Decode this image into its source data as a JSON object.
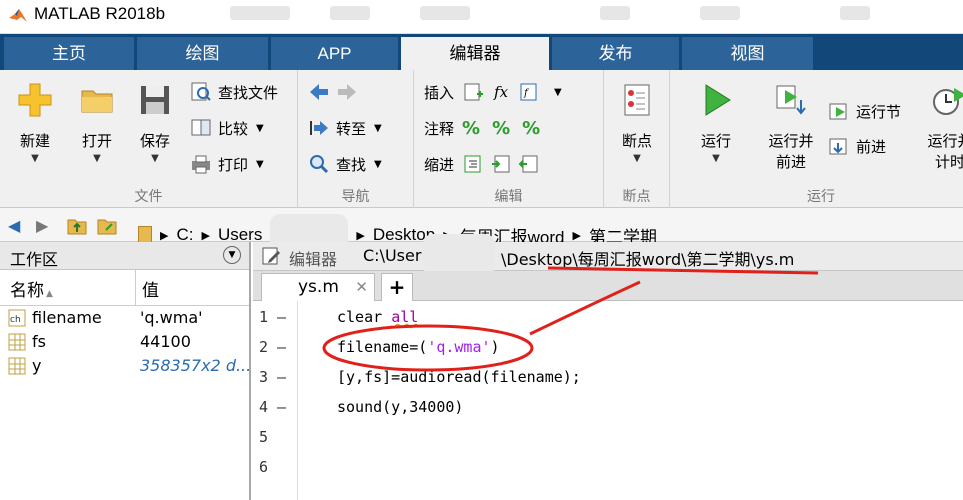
{
  "app": {
    "title": "MATLAB R2018b"
  },
  "tabs": [
    {
      "label": "主页",
      "active": false
    },
    {
      "label": "绘图",
      "active": false
    },
    {
      "label": "APP",
      "active": false
    },
    {
      "label": "编辑器",
      "active": true
    },
    {
      "label": "发布",
      "active": false
    },
    {
      "label": "视图",
      "active": false
    }
  ],
  "ribbon": {
    "file": {
      "label": "文件",
      "new": "新建",
      "open": "打开",
      "save": "保存",
      "find_files": "查找文件",
      "compare": "比较",
      "print": "打印"
    },
    "nav": {
      "label": "导航",
      "goto": "转至",
      "find": "查找"
    },
    "edit": {
      "label": "编辑",
      "insert": "插入",
      "comment": "注释",
      "indent": "缩进",
      "fx": "fx"
    },
    "breakpoints": {
      "label": "断点",
      "button": "断点"
    },
    "run": {
      "label": "运行",
      "run": "运行",
      "run_advance_1": "运行并",
      "run_advance_2": "前进",
      "run_section": "运行节",
      "advance": "前进",
      "run_time_1": "运行并",
      "run_time_2": "计时"
    }
  },
  "address": {
    "drive": "C:",
    "users": "Users",
    "desktop": "Desktop",
    "folder1": "每周汇报word",
    "folder2": "第二学期"
  },
  "workspace": {
    "title": "工作区",
    "col_name": "名称",
    "col_value": "值",
    "vars": [
      {
        "name": "filename",
        "value": "'q.wma'",
        "icon": "char-icon"
      },
      {
        "name": "fs",
        "value": "44100",
        "icon": "matrix-icon"
      },
      {
        "name": "y",
        "value": "358357x2 d...",
        "icon": "matrix-icon"
      }
    ]
  },
  "editor": {
    "header_prefix": "编辑器",
    "path_a": "C:\\User",
    "path_b": "\\Desktop\\每周汇报word\\第二学期\\ys.m",
    "file_tab": "ys.m",
    "close_glyph": "✕",
    "plus_glyph": "+",
    "lines": [
      {
        "num": "1",
        "a": "clear ",
        "b": "all",
        "c": ""
      },
      {
        "num": "2",
        "a": "filename=(",
        "b": "'q.wma'",
        "c": ")"
      },
      {
        "num": "3",
        "a": "[y,fs]=audioread(filename);",
        "b": "",
        "c": ""
      },
      {
        "num": "4",
        "a": "sound(y,34000)",
        "b": "",
        "c": ""
      },
      {
        "num": "5",
        "a": "",
        "b": "",
        "c": ""
      },
      {
        "num": "6",
        "a": "",
        "b": "",
        "c": ""
      }
    ]
  },
  "colors": {
    "tabbar": "#12477a",
    "tab": "#2c6499",
    "annotation": "#e0201a"
  }
}
